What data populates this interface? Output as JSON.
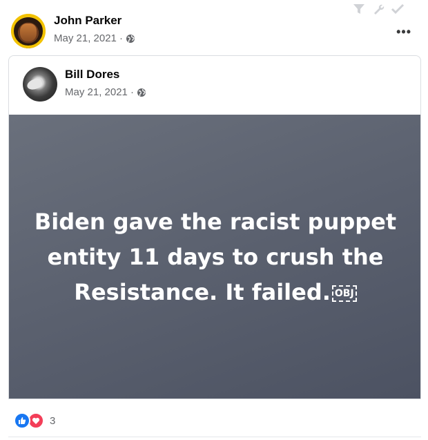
{
  "outer_post": {
    "author": "John Parker",
    "date": "May 21, 2021 ·",
    "more_label": "•••"
  },
  "shared_post": {
    "author": "Bill Dores",
    "date": "May 21, 2021 ·",
    "image_text_line1": "Biden gave the racist puppet",
    "image_text_line2": "entity 11 days to crush the",
    "image_text_line3": "Resistance. It failed.",
    "obj_glyph": "OBJ"
  },
  "reactions": {
    "count": "3",
    "types": [
      "like-icon",
      "love-icon"
    ]
  },
  "colors": {
    "image_bg": "#5c6270",
    "like": "#1877f2",
    "love": "#f33e58",
    "meta_text": "#65676b"
  }
}
